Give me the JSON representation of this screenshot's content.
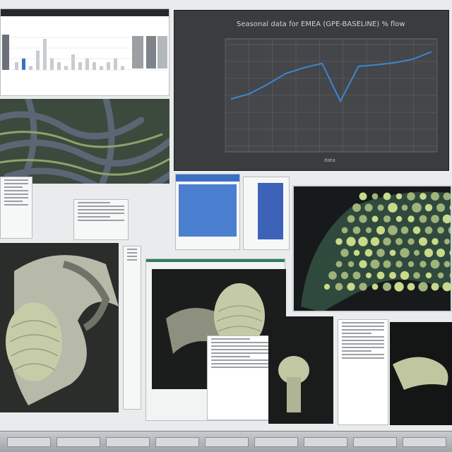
{
  "chart_panel": {
    "title": "Seasonal data for EMEA (GPE-BASELINE) % flow",
    "footer": "data",
    "accent": "#3b86d6"
  },
  "chart_data": {
    "type": "line",
    "x": [
      0,
      1,
      2,
      3,
      4,
      5,
      6,
      7,
      8,
      9,
      10,
      11
    ],
    "y": [
      135,
      128,
      115,
      100,
      92,
      86,
      138,
      90,
      88,
      85,
      80,
      70
    ],
    "ylim": [
      200,
      60
    ],
    "grid": true,
    "legend": "none"
  },
  "bar_chart": {
    "values": [
      2,
      3,
      1,
      5,
      8,
      3,
      2,
      1,
      4,
      2,
      3,
      2,
      1,
      2,
      3,
      1
    ],
    "accent": "#3b6fc4"
  },
  "micrographs": [
    {
      "name": "tissue-network"
    },
    {
      "name": "cell-cluster"
    },
    {
      "name": "organ-section"
    },
    {
      "name": "structure-closeup"
    },
    {
      "name": "tissue-fragment"
    }
  ]
}
